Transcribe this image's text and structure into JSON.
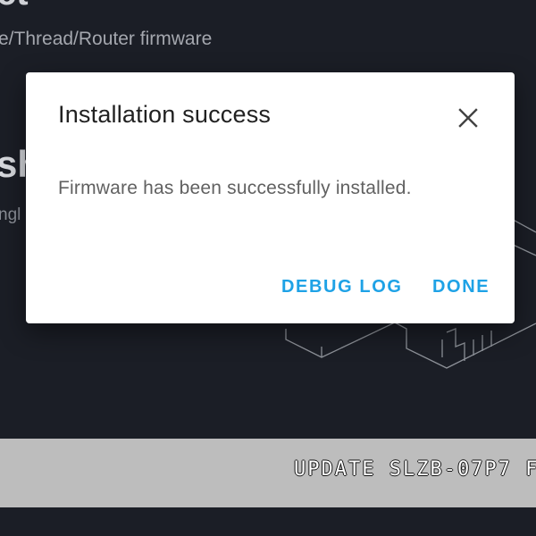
{
  "background": {
    "title_fragment": "ct",
    "subtitle": "e/Thread/Router firmware",
    "heading_fragment": "sh",
    "small_fragment": "ngl",
    "update_button_label": "UPDATE SLZB-07P7 F"
  },
  "dialog": {
    "title": "Installation success",
    "message": "Firmware has been successfully installed.",
    "close_icon": "close-icon",
    "actions": {
      "debug_log": "DEBUG LOG",
      "done": "DONE"
    }
  },
  "colors": {
    "page_background": "#1b1e26",
    "dialog_background": "#ffffff",
    "accent": "#1ea2e6",
    "update_bar": "#bdbdbd"
  }
}
